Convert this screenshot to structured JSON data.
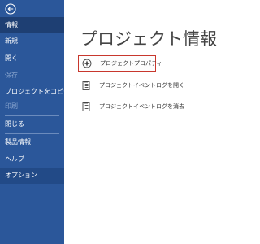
{
  "sidebar": {
    "items": [
      {
        "label": "情報"
      },
      {
        "label": "新規"
      },
      {
        "label": "開く"
      },
      {
        "label": "保存"
      },
      {
        "label": "プロジェクトをコピー"
      },
      {
        "label": "印刷"
      },
      {
        "label": "閉じる"
      },
      {
        "label": "製品情報"
      },
      {
        "label": "ヘルプ"
      },
      {
        "label": "オプション"
      }
    ]
  },
  "main": {
    "title": "プロジェクト情報",
    "actions": [
      {
        "label": "プロジェクトプロパティ",
        "icon": "gear-icon"
      },
      {
        "label": "プロジェクトイベントログを開く",
        "icon": "clipboard-icon"
      },
      {
        "label": "プロジェクトイベントログを消去",
        "icon": "clipboard-icon"
      }
    ]
  },
  "colors": {
    "sidebar_bg": "#2b579a",
    "sidebar_active": "#1e3f73",
    "highlight_border": "#c8372d"
  }
}
